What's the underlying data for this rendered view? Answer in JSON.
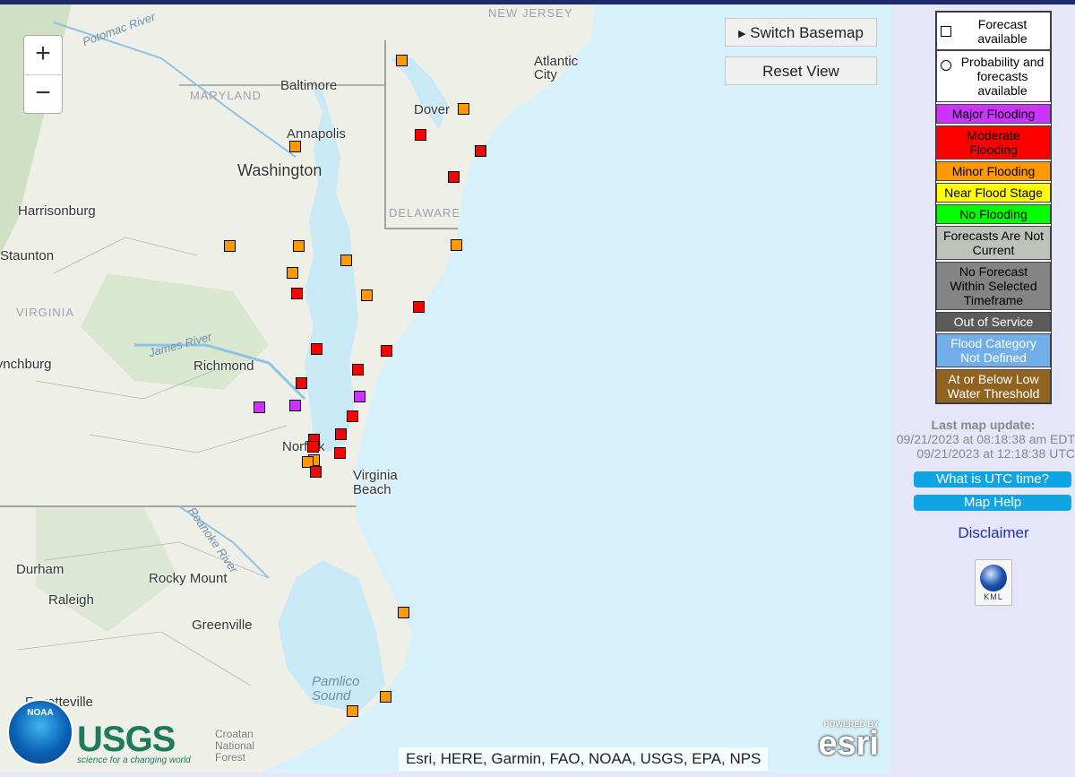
{
  "map": {
    "zoom_in_label": "+",
    "zoom_out_label": "−",
    "switch_basemap_label": "Switch Basemap",
    "reset_view_label": "Reset View",
    "attribution": "Esri, HERE, Garmin, FAO, NOAA, USGS, EPA, NPS",
    "places": [
      {
        "name": "Baltimore"
      },
      {
        "name": "Annapolis"
      },
      {
        "name": "Washington"
      },
      {
        "name": "Dover"
      },
      {
        "name": "Atlantic City"
      },
      {
        "name": "Harrisonburg"
      },
      {
        "name": "Staunton"
      },
      {
        "name": "Richmond"
      },
      {
        "name": "Lynchburg"
      },
      {
        "name": "Norfolk"
      },
      {
        "name": "Virginia Beach"
      },
      {
        "name": "Durham"
      },
      {
        "name": "Raleigh"
      },
      {
        "name": "Rocky Mount"
      },
      {
        "name": "Greenville"
      },
      {
        "name": "Fayetteville"
      },
      {
        "name": "Croatan National Forest"
      }
    ],
    "regions": [
      {
        "name": "NEW JERSEY"
      },
      {
        "name": "MARYLAND"
      },
      {
        "name": "DELAWARE"
      },
      {
        "name": "VIRGINIA"
      }
    ],
    "water": [
      {
        "name": "Potomac River"
      },
      {
        "name": "James River"
      },
      {
        "name": "Roanoke River"
      },
      {
        "name": "Pamlico Sound"
      }
    ],
    "logos": {
      "noaa": "NOAA",
      "usgs": "USGS",
      "usgs_tagline": "science for a changing world",
      "esri_powered": "POWERED BY",
      "esri": "esri"
    }
  },
  "colors": {
    "major": "#cc33ff",
    "moderate": "#ff0000",
    "minor": "#ff9900",
    "near": "#ffff00",
    "none": "#00ff00",
    "not_current": "#bdc2bb",
    "no_forecast": "#666666",
    "out_of_service": "#5b5b5b",
    "undefined": "#72afe9",
    "low_threshold": "#906320"
  },
  "gauges": [
    {
      "category": "minor"
    },
    {
      "category": "minor"
    },
    {
      "category": "moderate"
    },
    {
      "category": "moderate"
    },
    {
      "category": "minor"
    },
    {
      "category": "moderate"
    },
    {
      "category": "minor"
    },
    {
      "category": "minor"
    },
    {
      "category": "minor"
    },
    {
      "category": "minor"
    },
    {
      "category": "minor"
    },
    {
      "category": "moderate"
    },
    {
      "category": "minor"
    },
    {
      "category": "moderate"
    },
    {
      "category": "moderate"
    },
    {
      "category": "moderate"
    },
    {
      "category": "moderate"
    },
    {
      "category": "moderate"
    },
    {
      "category": "major"
    },
    {
      "category": "major"
    },
    {
      "category": "major"
    },
    {
      "category": "moderate"
    },
    {
      "category": "moderate"
    },
    {
      "category": "moderate"
    },
    {
      "category": "moderate"
    },
    {
      "category": "moderate"
    },
    {
      "category": "minor"
    },
    {
      "category": "minor"
    },
    {
      "category": "moderate"
    },
    {
      "category": "minor"
    },
    {
      "category": "minor"
    },
    {
      "category": "minor"
    }
  ],
  "legend": {
    "forecast_available": "Forecast available",
    "probability_available": "Probability and forecasts available",
    "items": [
      {
        "key": "major",
        "label": "Major Flooding",
        "bg": "#cc33ff",
        "fg": "#000000"
      },
      {
        "key": "moderate",
        "label": "Moderate Flooding",
        "bg": "#ff0000",
        "fg": "#000000"
      },
      {
        "key": "minor",
        "label": "Minor Flooding",
        "bg": "#ff9900",
        "fg": "#000000"
      },
      {
        "key": "near",
        "label": "Near Flood Stage",
        "bg": "#ffff00",
        "fg": "#000000"
      },
      {
        "key": "none",
        "label": "No Flooding",
        "bg": "#00ff00",
        "fg": "#000000"
      },
      {
        "key": "not_current",
        "label": "Forecasts Are Not Current",
        "bg": "#bdc2bb",
        "fg": "#000000"
      },
      {
        "key": "no_forecast",
        "label": "No Forecast Within Selected Timeframe",
        "bg": "#848484",
        "fg": "#000000"
      },
      {
        "key": "out_of_service",
        "label": "Out of Service",
        "bg": "#5b5b5b",
        "fg": "#ffffff"
      },
      {
        "key": "undefined",
        "label": "Flood Category Not Defined",
        "bg": "#72afe9",
        "fg": "#ffffff"
      },
      {
        "key": "low_threshold",
        "label": "At or Below Low Water Threshold",
        "bg": "#906320",
        "fg": "#ffffff"
      }
    ]
  },
  "update": {
    "heading": "Last map update",
    "edt": "09/21/2023 at 08:18:38 am EDT",
    "utc": "09/21/2023 at 12:18:38 UTC"
  },
  "panel": {
    "utc_button": "What is UTC time?",
    "help_button": "Map Help",
    "disclaimer": "Disclaimer",
    "kml_label": "KML"
  }
}
